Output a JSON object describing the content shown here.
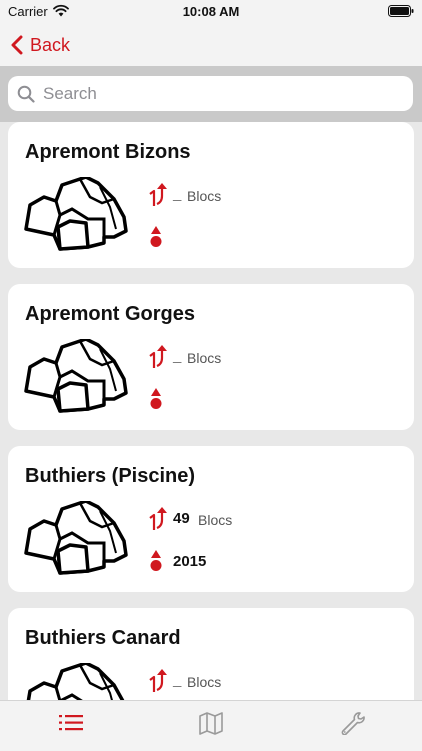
{
  "status_bar": {
    "carrier": "Carrier",
    "time": "10:08 AM"
  },
  "nav": {
    "back_label": "Back"
  },
  "search": {
    "placeholder": "Search",
    "value": ""
  },
  "crags": [
    {
      "name": "Apremont Bizons",
      "routes_count": "_",
      "routes_label": "Blocs",
      "altitude": ""
    },
    {
      "name": "Apremont Gorges",
      "routes_count": "_",
      "routes_label": "Blocs",
      "altitude": ""
    },
    {
      "name": "Buthiers (Piscine)",
      "routes_count": "49",
      "routes_label": "Blocs",
      "altitude": "2015"
    },
    {
      "name": "Buthiers Canard",
      "routes_count": "_",
      "routes_label": "Blocs",
      "altitude": ""
    }
  ],
  "icons": {
    "list_tab": "list-icon",
    "map_tab": "map-icon",
    "settings_tab": "wrench-icon",
    "routes": "route-arrow-icon",
    "altitude": "altitude-icon",
    "crag": "rock-icon"
  },
  "colors": {
    "accent": "#d0181f",
    "inactive_tab": "#9a9a9a",
    "list_background": "#e8e8e8"
  }
}
